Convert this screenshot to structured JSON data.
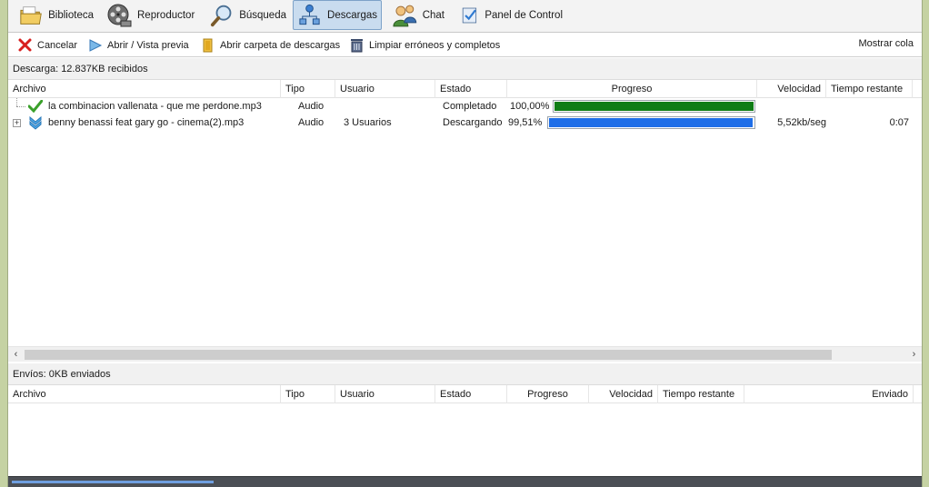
{
  "nav": {
    "items": [
      {
        "label": "Biblioteca",
        "icon": "folder-icon"
      },
      {
        "label": "Reproductor",
        "icon": "film-reel-icon"
      },
      {
        "label": "Búsqueda",
        "icon": "magnifier-icon"
      },
      {
        "label": "Descargas",
        "icon": "network-download-icon",
        "active": true
      },
      {
        "label": "Chat",
        "icon": "users-chat-icon"
      },
      {
        "label": "Panel de Control",
        "icon": "control-panel-icon"
      }
    ]
  },
  "toolbar": {
    "cancel_label": "Cancelar",
    "open_preview_label": "Abrir / Vista previa",
    "open_folder_label": "Abrir carpeta de descargas",
    "clear_label": "Limpiar erróneos y completos",
    "show_queue_label": "Mostrar cola"
  },
  "downloads": {
    "header": "Descarga: 12.837KB recibidos",
    "columns": {
      "file": "Archivo",
      "type": "Tipo",
      "user": "Usuario",
      "state": "Estado",
      "progress": "Progreso",
      "speed": "Velocidad",
      "remaining": "Tiempo restante"
    },
    "rows": [
      {
        "file": "la combinacion vallenata - que me perdone.mp3",
        "type": "Audio",
        "user": "",
        "state": "Completado",
        "percent": "100,00%",
        "progress_fraction": 1.0,
        "bar_color": "#0f7d16",
        "speed": "",
        "remaining": "",
        "icon": "checkmark-icon"
      },
      {
        "file": "benny benassi feat gary go - cinema(2).mp3",
        "type": "Audio",
        "user": "3 Usuarios",
        "state": "Descargando",
        "percent": "99,51%",
        "progress_fraction": 0.9951,
        "bar_color": "#1e6ee8",
        "speed": "5,52kb/seg",
        "remaining": "0:07",
        "icon": "download-arrow-icon"
      }
    ]
  },
  "uploads": {
    "header": "Envíos: 0KB enviados",
    "columns": {
      "file": "Archivo",
      "type": "Tipo",
      "user": "Usuario",
      "state": "Estado",
      "progress": "Progreso",
      "speed": "Velocidad",
      "remaining": "Tiempo restante",
      "sent": "Enviado"
    }
  }
}
